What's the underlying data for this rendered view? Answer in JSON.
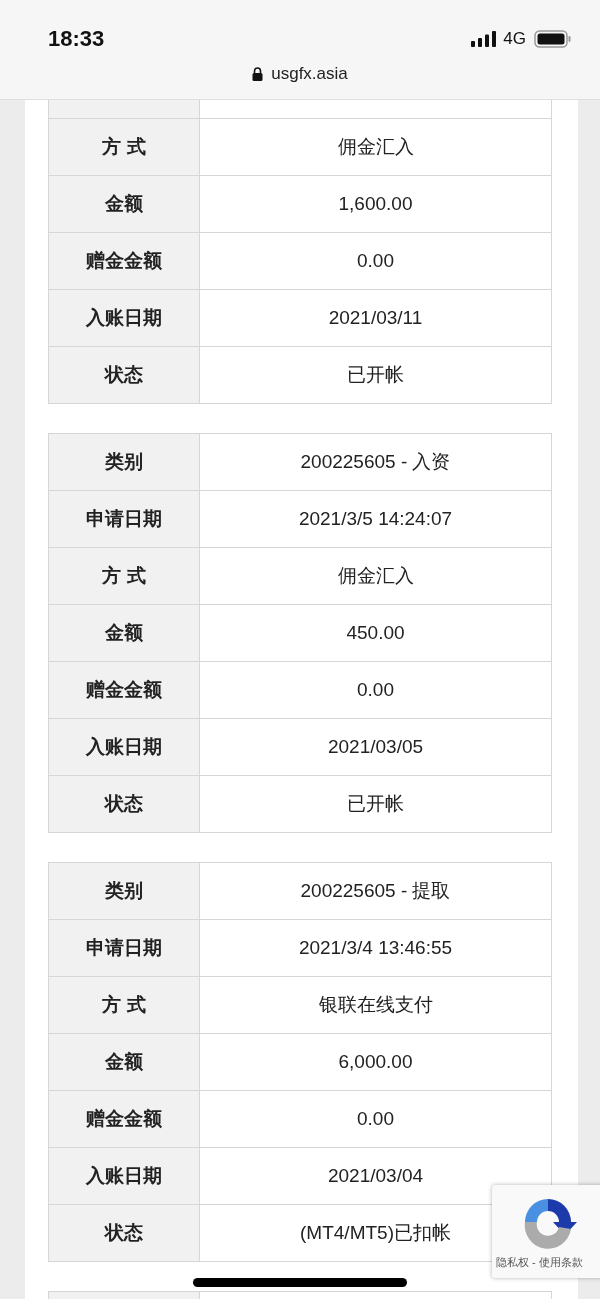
{
  "status_bar": {
    "time": "18:33",
    "network": "4G"
  },
  "address_bar": {
    "url": "usgfx.asia"
  },
  "records": [
    {
      "rows": [
        {
          "label": "方 式",
          "value": "佣金汇入"
        },
        {
          "label": "金额",
          "value": "1,600.00"
        },
        {
          "label": "赠金金额",
          "value": "0.00"
        },
        {
          "label": "入账日期",
          "value": "2021/03/11"
        },
        {
          "label": "状态",
          "value": "已开帐"
        }
      ]
    },
    {
      "rows": [
        {
          "label": "类别",
          "value": "200225605 - 入资"
        },
        {
          "label": "申请日期",
          "value": "2021/3/5 14:24:07"
        },
        {
          "label": "方 式",
          "value": "佣金汇入"
        },
        {
          "label": "金额",
          "value": "450.00"
        },
        {
          "label": "赠金金额",
          "value": "0.00"
        },
        {
          "label": "入账日期",
          "value": "2021/03/05"
        },
        {
          "label": "状态",
          "value": "已开帐"
        }
      ]
    },
    {
      "rows": [
        {
          "label": "类别",
          "value": "200225605 - 提取"
        },
        {
          "label": "申请日期",
          "value": "2021/3/4 13:46:55"
        },
        {
          "label": "方 式",
          "value": "银联在线支付"
        },
        {
          "label": "金额",
          "value": "6,000.00"
        },
        {
          "label": "赠金金额",
          "value": "0.00"
        },
        {
          "label": "入账日期",
          "value": "2021/03/04"
        },
        {
          "label": "状态",
          "value": "(MT4/MT5)已扣帐"
        }
      ]
    }
  ],
  "recaptcha": {
    "links": "隐私权 - 使用条款"
  }
}
